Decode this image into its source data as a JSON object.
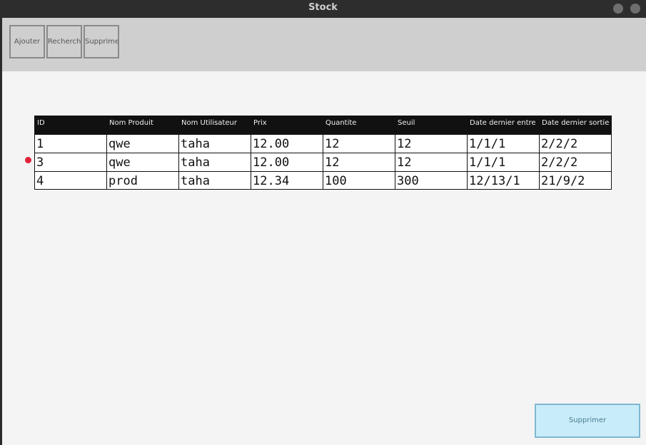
{
  "window": {
    "title": "Stock"
  },
  "toolbar": {
    "buttons": [
      {
        "label": "Ajouter"
      },
      {
        "label": "Recherch"
      },
      {
        "label": "Supprimer"
      }
    ]
  },
  "table": {
    "columns": [
      "ID",
      "Nom Produit",
      "Nom Utilisateur",
      "Prix",
      "Quantite",
      "Seuil",
      "Date dernier entre",
      "Date dernier sortie"
    ],
    "rows": [
      [
        "1",
        "qwe",
        "taha",
        "12.00",
        "12",
        "12",
        "1/1/1",
        "2/2/2"
      ],
      [
        "3",
        "qwe",
        "taha",
        "12.00",
        "12",
        "12",
        "1/1/1",
        "2/2/2"
      ],
      [
        "4",
        "prod",
        "taha",
        "12.34",
        "100",
        "300",
        "12/13/1",
        "21/9/2"
      ]
    ],
    "selected_row_marker_color": "#e0203a"
  },
  "footer": {
    "delete_label": "Supprimer"
  },
  "colors": {
    "toolbar_bg": "#cfcfcf",
    "header_bg": "#111111",
    "delete_button_bg": "#c8ecf9"
  }
}
